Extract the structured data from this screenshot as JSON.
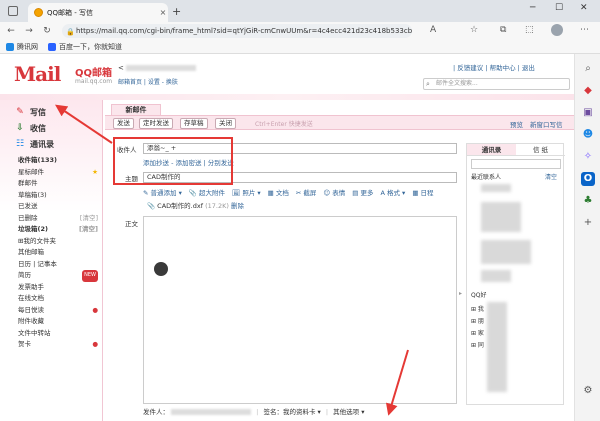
{
  "browser": {
    "tab_title": "QQ邮箱 - 写信",
    "tab_close": "×",
    "new_tab": "+",
    "url": "https://mail.qq.com/cgi-bin/frame_html?sid=qtYjGiR-cmCnwUUm&r=4c4ecc421d23c418b533cb...",
    "bookmarks": [
      {
        "label": "腾讯网",
        "color": "#1e88e5"
      },
      {
        "label": "百度一下，你就知道",
        "color": "#2962ff"
      }
    ],
    "sidebar_icons": [
      {
        "name": "search-icon",
        "glyph": "⌕",
        "color": "#555"
      },
      {
        "name": "tag-icon",
        "glyph": "◆",
        "color": "#d8373c"
      },
      {
        "name": "toolbox-icon",
        "glyph": "▣",
        "color": "#6d4c9f"
      },
      {
        "name": "people-icon",
        "glyph": "☻",
        "color": "#1e88e5"
      },
      {
        "name": "copilot-icon",
        "glyph": "✧",
        "color": "#7b61ff"
      },
      {
        "name": "outlook-icon",
        "glyph": "O",
        "color": "#0a64c8"
      },
      {
        "name": "tree-icon",
        "glyph": "♣",
        "color": "#2e7d32"
      },
      {
        "name": "add-icon",
        "glyph": "+",
        "color": "#555"
      }
    ]
  },
  "mail": {
    "logo": "Mail",
    "logo_sub": "QQ邮箱",
    "logo_domain": "mail.qq.com",
    "user_prefix": "<",
    "user_links": "邮箱首页 | 设置 - 换肤",
    "top_links": "| 反馈建议 | 帮助中心 | 退出",
    "search_placeholder": "邮件全文搜索..."
  },
  "leftnav": {
    "write": "写信",
    "receive": "收信",
    "contacts": "通讯录",
    "items": [
      {
        "label": "收件箱(133)",
        "extra": "",
        "style": "bold"
      },
      {
        "label": "星标邮件",
        "extra": "★",
        "style": "star"
      },
      {
        "label": "群邮件",
        "extra": "",
        "style": ""
      },
      {
        "label": "草稿箱(3)",
        "extra": "",
        "style": ""
      },
      {
        "label": "已发送",
        "extra": "",
        "style": ""
      },
      {
        "label": "已删除",
        "extra": "[清空]",
        "style": "muted"
      },
      {
        "label": "垃圾箱(2)",
        "extra": "[清空]",
        "style": "bold"
      },
      {
        "label": "⊞我的文件夹",
        "extra": "",
        "style": ""
      },
      {
        "label": "其他邮箱",
        "extra": "",
        "style": ""
      },
      {
        "label": "",
        "extra": "",
        "style": ""
      },
      {
        "label": "日历 | 记事本",
        "extra": "",
        "style": ""
      },
      {
        "label": "简历",
        "extra": "NEW",
        "style": "badge"
      },
      {
        "label": "发票助手",
        "extra": "",
        "style": ""
      },
      {
        "label": "在线文档",
        "extra": "",
        "style": ""
      },
      {
        "label": "每日悦读",
        "extra": "●",
        "style": "dot"
      },
      {
        "label": "附件收藏",
        "extra": "",
        "style": ""
      },
      {
        "label": "文件中转站",
        "extra": "",
        "style": ""
      },
      {
        "label": "贺卡",
        "extra": "●",
        "style": "dot"
      }
    ]
  },
  "compose": {
    "tab_label": "新邮件",
    "toolbar": {
      "send": "发送",
      "schedule": "定时发送",
      "save_draft": "存草稿",
      "close": "关闭",
      "hint": "Ctrl+Enter 快捷发送",
      "preview": "预览",
      "new_window": "新窗口写信"
    },
    "to_label": "收件人",
    "to_value": "添翁~_ +",
    "to_links": "添加抄送 - 添加密送 | 分别发送",
    "subject_label": "主题",
    "subject_value": "CAD制作的",
    "format_items": [
      "✎ 普通添加 ▾",
      "📎 超大附件",
      "🖼 照片 ▾",
      "▦ 文档",
      "✂ 截屏",
      "☺ 表情",
      "▤ 更多",
      "A 格式 ▾",
      "▦ 日程"
    ],
    "attachment_name": "CAD制作的.dxf",
    "attachment_size": "(17.2K)",
    "attachment_delete": "删除",
    "body_label": "正文",
    "collapse": "▸"
  },
  "contacts": {
    "tab_contacts": "通讯录",
    "tab_other": "信 纸",
    "recent_title": "最近联系人",
    "clear": "清空",
    "qq_title": "QQ好",
    "qq_items": [
      "⊞ 我",
      "⊞ 朋",
      "⊞ 家",
      "⊞ 同"
    ]
  },
  "footer": {
    "sender_label": "发件人：",
    "signature_label": "签名：我的资料卡 ▾",
    "other_options": "其他选项 ▾"
  },
  "annotations": {
    "highlight_color": "#e53935"
  }
}
